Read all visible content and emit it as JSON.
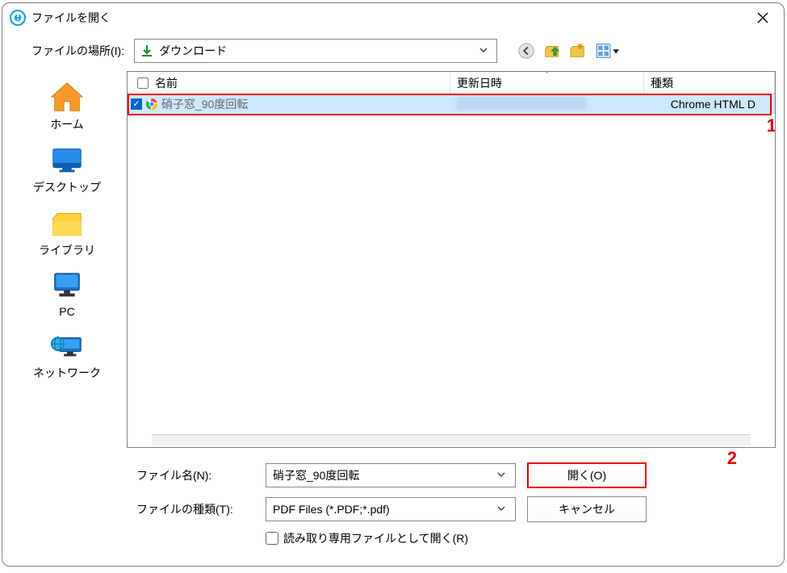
{
  "window": {
    "title": "ファイルを開く"
  },
  "location": {
    "label": "ファイルの場所(I):",
    "value": "ダウンロード"
  },
  "places": [
    {
      "id": "home",
      "label": "ホーム"
    },
    {
      "id": "desktop",
      "label": "デスクトップ"
    },
    {
      "id": "library",
      "label": "ライブラリ"
    },
    {
      "id": "pc",
      "label": "PC"
    },
    {
      "id": "network",
      "label": "ネットワーク"
    }
  ],
  "file_list": {
    "columns": {
      "name": "名前",
      "date": "更新日時",
      "type": "種類"
    },
    "rows": [
      {
        "checked": true,
        "icon": "chrome",
        "name": "硝子窓_90度回転",
        "date_blurred": true,
        "type": "Chrome HTML D"
      }
    ]
  },
  "bottom": {
    "filename_label": "ファイル名(N):",
    "filename_value": "硝子窓_90度回転",
    "filetype_label": "ファイルの種類(T):",
    "filetype_value": "PDF Files (*.PDF;*.pdf)",
    "readonly_label": "読み取り専用ファイルとして開く(R)",
    "open_button": "開く(O)",
    "cancel_button": "キャンセル"
  },
  "annotations": {
    "one": "1",
    "two": "2"
  }
}
